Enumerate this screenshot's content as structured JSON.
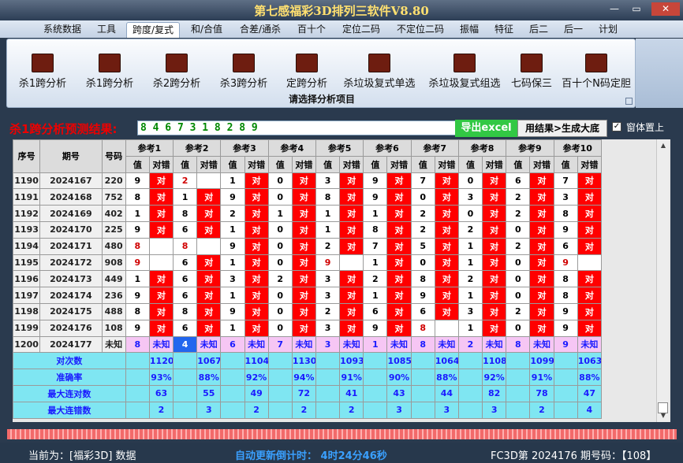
{
  "app": {
    "title": "第七感福彩3D排列三软件V8.80"
  },
  "window_buttons": [
    "—",
    "▭",
    "✕"
  ],
  "menu": {
    "tabs": [
      "系统数据",
      "工具",
      "跨度/复式",
      "和/合值",
      "合差/通杀",
      "百十个",
      "定位二码",
      "不定位二码",
      "振幅",
      "特征",
      "后二",
      "后一",
      "计划"
    ]
  },
  "ribbon": {
    "buttons": [
      "杀1跨分析",
      "杀1跨分析",
      "杀2跨分析",
      "杀3跨分析",
      "定跨分析",
      "杀垃圾复式单选",
      "杀垃圾复式组选",
      "七码保三",
      "百十个N码定胆"
    ],
    "caption": "请选择分析项目",
    "icon": "chart-icon"
  },
  "result": {
    "label": "杀1跨分析预测结果:",
    "value": "8 4 6 7 3 1 8 2 8 9",
    "export_button": "导出excel",
    "generate_button": "用结果>生成大底",
    "pin_label": "窗体置上",
    "pin_checked": true
  },
  "table": {
    "headers": {
      "seq": "序号",
      "period": "期号",
      "number": "号码",
      "sub_value": "值",
      "sub_check": "对错",
      "groups": [
        "参考1",
        "参考2",
        "参考3",
        "参考4",
        "参考5",
        "参考6",
        "参考7",
        "参考8",
        "参考9",
        "参考10"
      ]
    },
    "rows": [
      {
        "seq": "1190",
        "period": "2024167",
        "number": "220",
        "cells": [
          [
            "9",
            "对"
          ],
          [
            "2",
            ""
          ],
          [
            "1",
            "对"
          ],
          [
            "0",
            "对"
          ],
          [
            "3",
            "对"
          ],
          [
            "9",
            "对"
          ],
          [
            "7",
            "对"
          ],
          [
            "0",
            "对"
          ],
          [
            "6",
            "对"
          ],
          [
            "7",
            "对"
          ]
        ]
      },
      {
        "seq": "1191",
        "period": "2024168",
        "number": "752",
        "cells": [
          [
            "8",
            "对"
          ],
          [
            "1",
            "对"
          ],
          [
            "9",
            "对"
          ],
          [
            "0",
            "对"
          ],
          [
            "8",
            "对"
          ],
          [
            "9",
            "对"
          ],
          [
            "0",
            "对"
          ],
          [
            "3",
            "对"
          ],
          [
            "2",
            "对"
          ],
          [
            "3",
            "对"
          ]
        ]
      },
      {
        "seq": "1192",
        "period": "2024169",
        "number": "402",
        "cells": [
          [
            "1",
            "对"
          ],
          [
            "8",
            "对"
          ],
          [
            "2",
            "对"
          ],
          [
            "1",
            "对"
          ],
          [
            "1",
            "对"
          ],
          [
            "1",
            "对"
          ],
          [
            "2",
            "对"
          ],
          [
            "0",
            "对"
          ],
          [
            "2",
            "对"
          ],
          [
            "8",
            "对"
          ]
        ]
      },
      {
        "seq": "1193",
        "period": "2024170",
        "number": "225",
        "cells": [
          [
            "9",
            "对"
          ],
          [
            "6",
            "对"
          ],
          [
            "1",
            "对"
          ],
          [
            "0",
            "对"
          ],
          [
            "1",
            "对"
          ],
          [
            "8",
            "对"
          ],
          [
            "2",
            "对"
          ],
          [
            "2",
            "对"
          ],
          [
            "0",
            "对"
          ],
          [
            "9",
            "对"
          ]
        ]
      },
      {
        "seq": "1194",
        "period": "2024171",
        "number": "480",
        "cells": [
          [
            "8",
            ""
          ],
          [
            "8",
            ""
          ],
          [
            "9",
            "对"
          ],
          [
            "0",
            "对"
          ],
          [
            "2",
            "对"
          ],
          [
            "7",
            "对"
          ],
          [
            "5",
            "对"
          ],
          [
            "1",
            "对"
          ],
          [
            "2",
            "对"
          ],
          [
            "6",
            "对"
          ]
        ]
      },
      {
        "seq": "1195",
        "period": "2024172",
        "number": "908",
        "cells": [
          [
            "9",
            ""
          ],
          [
            "6",
            "对"
          ],
          [
            "1",
            "对"
          ],
          [
            "0",
            "对"
          ],
          [
            "9",
            ""
          ],
          [
            "1",
            "对"
          ],
          [
            "0",
            "对"
          ],
          [
            "1",
            "对"
          ],
          [
            "0",
            "对"
          ],
          [
            "9",
            ""
          ]
        ]
      },
      {
        "seq": "1196",
        "period": "2024173",
        "number": "449",
        "cells": [
          [
            "1",
            "对"
          ],
          [
            "6",
            "对"
          ],
          [
            "3",
            "对"
          ],
          [
            "2",
            "对"
          ],
          [
            "3",
            "对"
          ],
          [
            "2",
            "对"
          ],
          [
            "8",
            "对"
          ],
          [
            "2",
            "对"
          ],
          [
            "0",
            "对"
          ],
          [
            "8",
            "对"
          ]
        ]
      },
      {
        "seq": "1197",
        "period": "2024174",
        "number": "236",
        "cells": [
          [
            "9",
            "对"
          ],
          [
            "6",
            "对"
          ],
          [
            "1",
            "对"
          ],
          [
            "0",
            "对"
          ],
          [
            "3",
            "对"
          ],
          [
            "1",
            "对"
          ],
          [
            "9",
            "对"
          ],
          [
            "1",
            "对"
          ],
          [
            "0",
            "对"
          ],
          [
            "8",
            "对"
          ]
        ]
      },
      {
        "seq": "1198",
        "period": "2024175",
        "number": "488",
        "cells": [
          [
            "8",
            "对"
          ],
          [
            "8",
            "对"
          ],
          [
            "9",
            "对"
          ],
          [
            "0",
            "对"
          ],
          [
            "2",
            "对"
          ],
          [
            "6",
            "对"
          ],
          [
            "6",
            "对"
          ],
          [
            "3",
            "对"
          ],
          [
            "2",
            "对"
          ],
          [
            "9",
            "对"
          ]
        ]
      },
      {
        "seq": "1199",
        "period": "2024176",
        "number": "108",
        "cells": [
          [
            "9",
            "对"
          ],
          [
            "6",
            "对"
          ],
          [
            "1",
            "对"
          ],
          [
            "0",
            "对"
          ],
          [
            "3",
            "对"
          ],
          [
            "9",
            "对"
          ],
          [
            "8",
            ""
          ],
          [
            "1",
            "对"
          ],
          [
            "0",
            "对"
          ],
          [
            "9",
            "对"
          ]
        ]
      },
      {
        "seq": "1200",
        "period": "2024177",
        "number": "未知",
        "cells": [
          [
            "8",
            "未知"
          ],
          [
            "4",
            "未知"
          ],
          [
            "6",
            "未知"
          ],
          [
            "7",
            "未知"
          ],
          [
            "3",
            "未知"
          ],
          [
            "1",
            "未知"
          ],
          [
            "8",
            "未知"
          ],
          [
            "2",
            "未知"
          ],
          [
            "8",
            "未知"
          ],
          [
            "9",
            "未知"
          ]
        ]
      }
    ],
    "summary": [
      {
        "label": "对次数",
        "values": [
          "1120",
          "1067",
          "1104",
          "1130",
          "1093",
          "1085",
          "1064",
          "1108",
          "1099",
          "1063"
        ]
      },
      {
        "label": "准确率",
        "values": [
          "93%",
          "88%",
          "92%",
          "94%",
          "91%",
          "90%",
          "88%",
          "92%",
          "91%",
          "88%"
        ]
      },
      {
        "label": "最大连对数",
        "values": [
          "63",
          "55",
          "49",
          "72",
          "41",
          "43",
          "44",
          "82",
          "78",
          "47"
        ]
      },
      {
        "label": "最大连错数",
        "values": [
          "2",
          "3",
          "2",
          "2",
          "2",
          "3",
          "3",
          "3",
          "2",
          "4"
        ]
      }
    ]
  },
  "status": {
    "current": "当前为：[福彩3D] 数据",
    "countdown": "自动更新倒计时：  4时24分46秒",
    "info": "FC3D第  2024176  期号码：【108】"
  },
  "colors": {
    "correct": "#ff0000",
    "wrong_value": "#d00000",
    "prediction_row": "#f6c6f4",
    "summary": "#7fe6f2",
    "accent_title": "#ffe070"
  }
}
